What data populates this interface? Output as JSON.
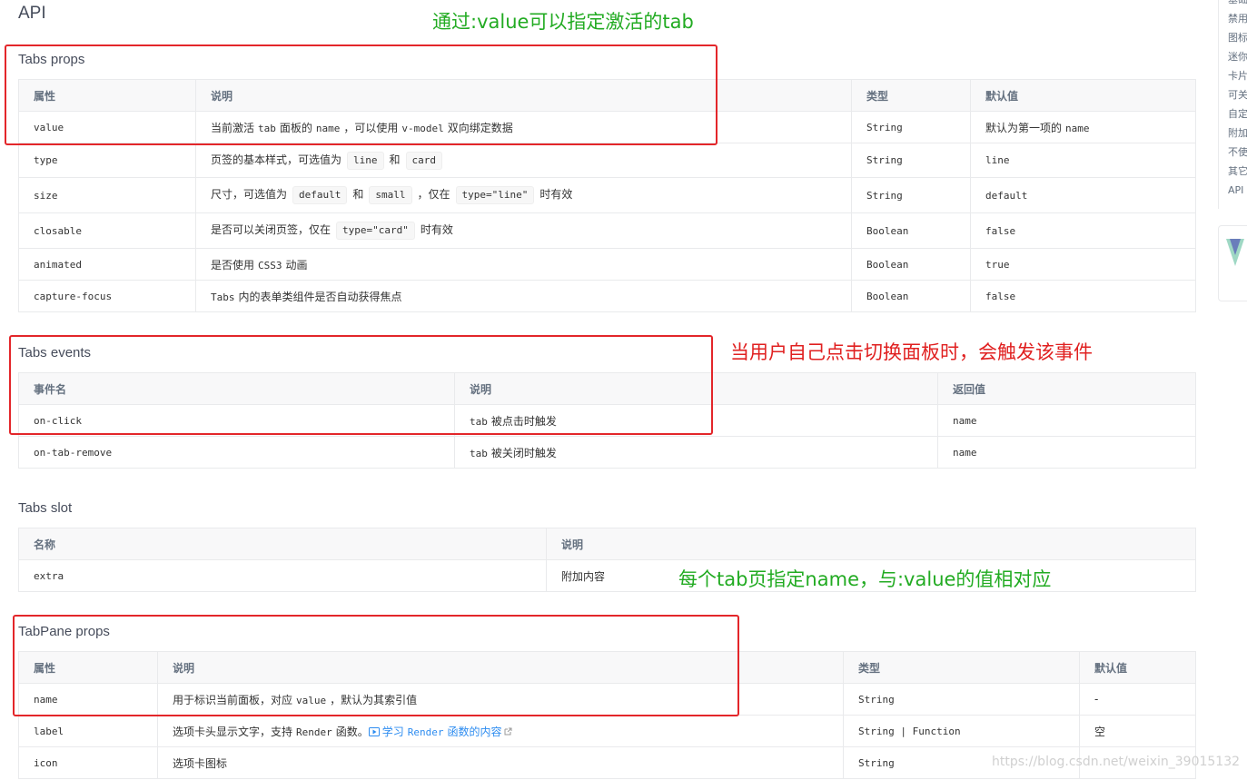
{
  "page": {
    "title": "API"
  },
  "annotations": {
    "top": "通过:value可以指定激活的tab",
    "events": "当用户自己点击切换面板时，会触发该事件",
    "slot": "每个tab页指定name，与:value的值相对应"
  },
  "tabs_props": {
    "title": "Tabs props",
    "headers": [
      "属性",
      "说明",
      "类型",
      "默认值"
    ],
    "rows": [
      {
        "name": "value",
        "desc_a": "当前激活",
        "desc_code1": "tab",
        "desc_b": "面板的",
        "desc_code2": "name",
        "desc_c": "，可以使用",
        "desc_code3": "v-model",
        "desc_d": "双向绑定数据",
        "type": "String",
        "default_a": "默认为第一项的",
        "default_code": "name"
      },
      {
        "name": "type",
        "desc_a": "页签的基本样式，可选值为",
        "pill1": "line",
        "and": "和",
        "pill2": "card",
        "type": "String",
        "default": "line"
      },
      {
        "name": "size",
        "desc_a": "尺寸，可选值为",
        "pill1": "default",
        "and": "和",
        "pill2": "small",
        "desc_b": "，仅在",
        "pill3": "type=\"line\"",
        "desc_c": "时有效",
        "type": "String",
        "default": "default"
      },
      {
        "name": "closable",
        "desc_a": "是否可以关闭页签，仅在",
        "pill1": "type=\"card\"",
        "desc_b": "时有效",
        "type": "Boolean",
        "default": "false"
      },
      {
        "name": "animated",
        "desc_a": "是否使用",
        "desc_code1": "CSS3",
        "desc_b": "动画",
        "type": "Boolean",
        "default": "true"
      },
      {
        "name": "capture-focus",
        "desc_code1": "Tabs",
        "desc_a": "内的表单类组件是否自动获得焦点",
        "type": "Boolean",
        "default": "false"
      }
    ]
  },
  "tabs_events": {
    "title": "Tabs events",
    "headers": [
      "事件名",
      "说明",
      "返回值"
    ],
    "rows": [
      {
        "name": "on-click",
        "desc_code": "tab",
        "desc": "被点击时触发",
        "ret": "name"
      },
      {
        "name": "on-tab-remove",
        "desc_code": "tab",
        "desc": "被关闭时触发",
        "ret": "name"
      }
    ]
  },
  "tabs_slot": {
    "title": "Tabs slot",
    "headers": [
      "名称",
      "说明"
    ],
    "rows": [
      {
        "name": "extra",
        "desc": "附加内容"
      }
    ]
  },
  "tabpane_props": {
    "title": "TabPane props",
    "headers": [
      "属性",
      "说明",
      "类型",
      "默认值"
    ],
    "rows": [
      {
        "name": "name",
        "desc_a": "用于标识当前面板，对应",
        "desc_code": "value",
        "desc_b": "，默认为其索引值",
        "type": "String",
        "default": "-"
      },
      {
        "name": "label",
        "desc_a": "选项卡头显示文字，支持",
        "desc_code": "Render",
        "desc_b": "函数。",
        "link_a": "学习",
        "link_code": "Render",
        "link_b": "函数的内容",
        "type": "String | Function",
        "default": "空"
      },
      {
        "name": "icon",
        "desc_a": "选项卡图标",
        "type": "String",
        "default": ""
      }
    ]
  },
  "sidebar": {
    "items": [
      "基础",
      "禁用",
      "图标",
      "迷你",
      "卡片",
      "可关",
      "自定",
      "附加",
      "不使",
      "其它",
      "API"
    ]
  },
  "watermark": "https://blog.csdn.net/weixin_39015132",
  "colors": {
    "annotation_green": "#22ab22",
    "annotation_red": "#e02020",
    "highlight_box": "#e3262a",
    "link": "#2d8cf0"
  }
}
